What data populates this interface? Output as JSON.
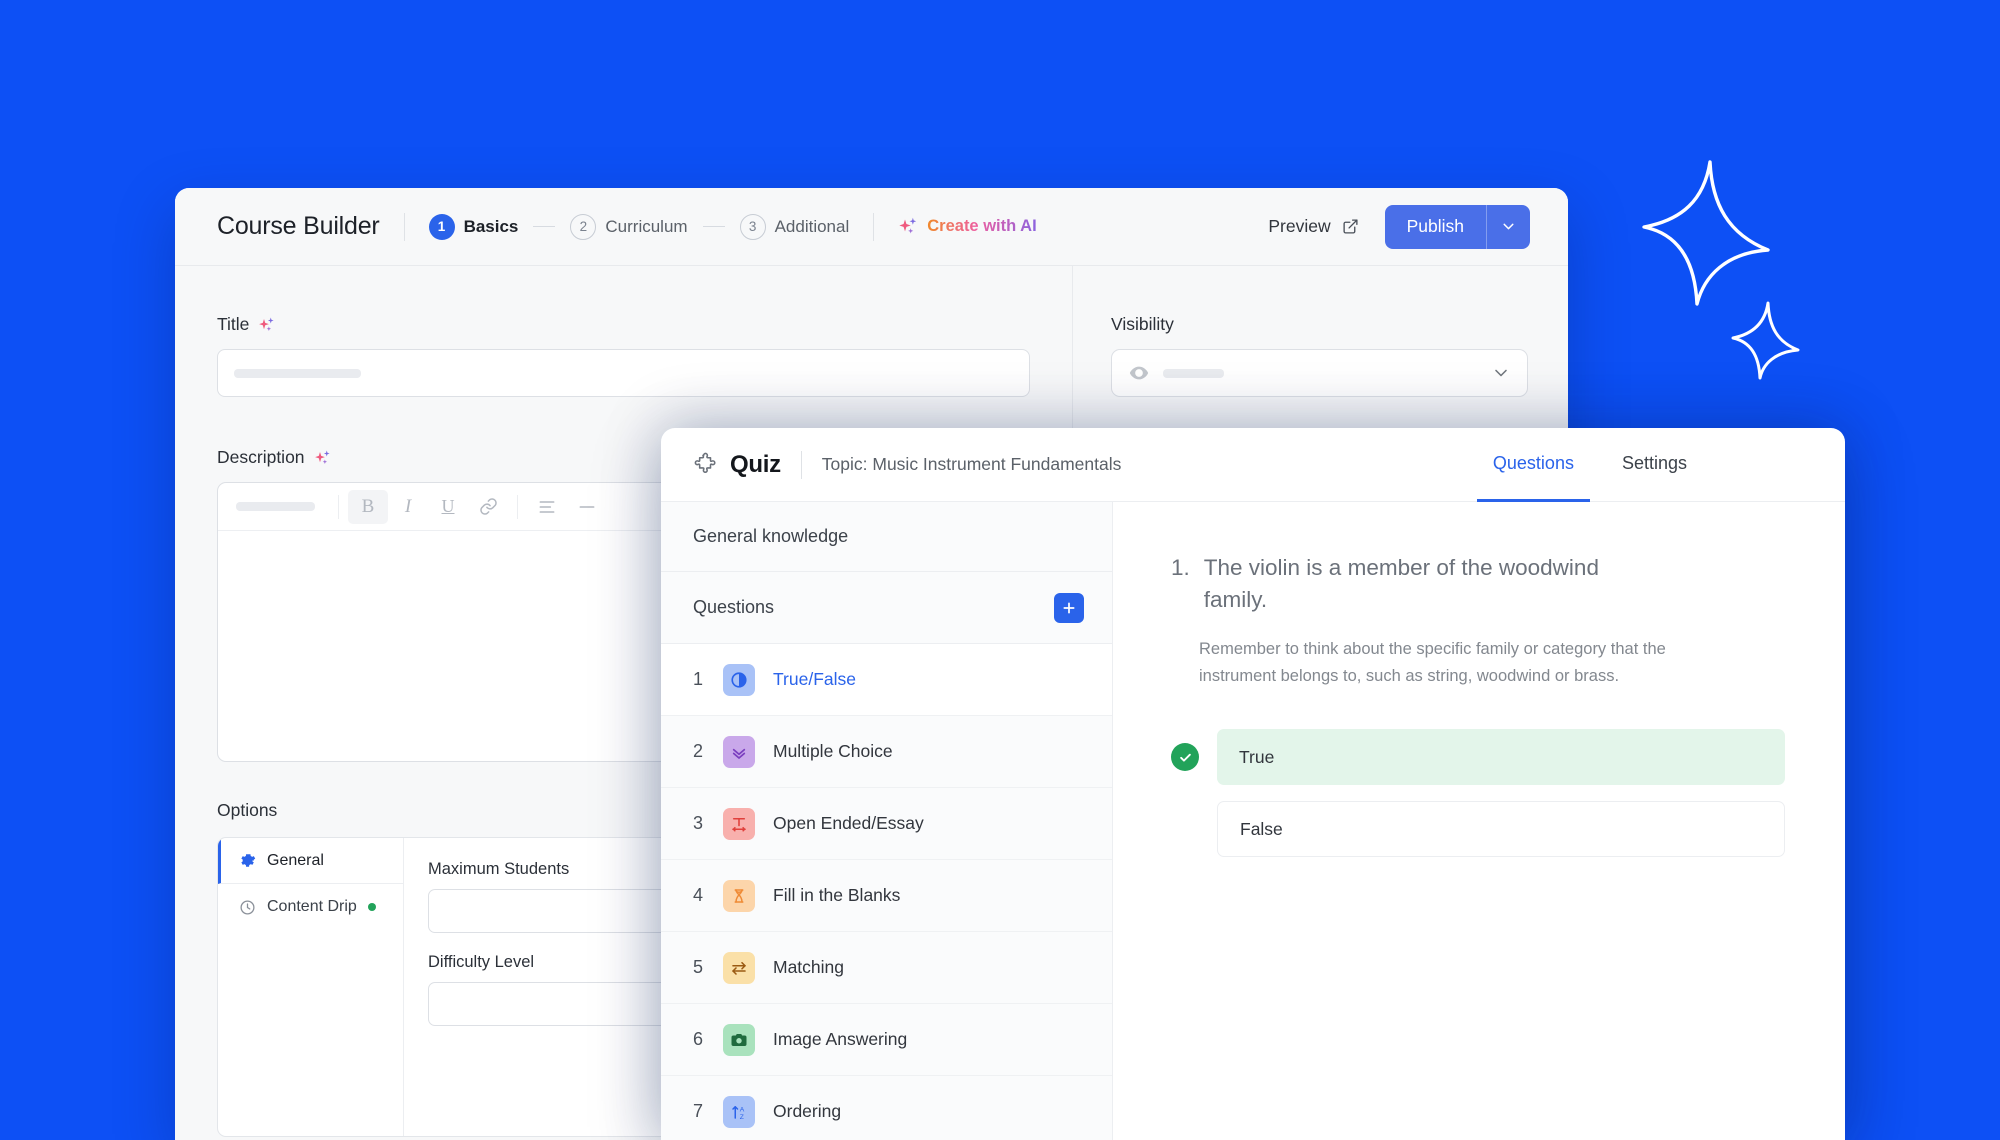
{
  "background": {
    "color": "#0d50f5"
  },
  "sparkles": [
    {
      "name": "sparkle-large"
    },
    {
      "name": "sparkle-small"
    }
  ],
  "course_builder": {
    "title": "Course Builder",
    "steps": [
      {
        "num": "1",
        "label": "Basics",
        "state": "active"
      },
      {
        "num": "2",
        "label": "Curriculum",
        "state": "idle"
      },
      {
        "num": "3",
        "label": "Additional",
        "state": "idle"
      }
    ],
    "create_with_ai": {
      "label": "Create with AI",
      "icon": "sparkles-icon"
    },
    "preview": {
      "label": "Preview",
      "icon": "external-link-icon"
    },
    "publish": {
      "label": "Publish",
      "dropdown_icon": "chevron-down-icon",
      "color": "#4a6fe8"
    },
    "fields": {
      "title": {
        "label": "Title",
        "ai_icon": "sparkles-icon",
        "value": ""
      },
      "visibility": {
        "label": "Visibility",
        "icon": "eye-icon",
        "value": "",
        "chevron": "chevron-down-icon"
      },
      "description": {
        "label": "Description",
        "ai_icon": "sparkles-icon",
        "value": ""
      }
    },
    "editor_toolbar": [
      {
        "name": "format-dropdown",
        "glyph": ""
      },
      {
        "name": "bold-icon",
        "glyph": "B"
      },
      {
        "name": "italic-icon",
        "glyph": "I"
      },
      {
        "name": "underline-icon",
        "glyph": "U"
      },
      {
        "name": "link-icon",
        "glyph": "🔗"
      },
      {
        "name": "align-left-icon",
        "glyph": "☰"
      },
      {
        "name": "horizontal-rule-icon",
        "glyph": "—"
      }
    ],
    "options": {
      "title": "Options",
      "tabs": [
        {
          "label": "General",
          "icon": "gear-icon",
          "active": true,
          "dot": false
        },
        {
          "label": "Content Drip",
          "icon": "clock-icon",
          "active": false,
          "dot": true,
          "dot_color": "#22a35a"
        }
      ],
      "form": [
        {
          "label": "Maximum Students",
          "value": ""
        },
        {
          "label": "Difficulty Level",
          "value": ""
        }
      ]
    }
  },
  "quiz": {
    "brand_icon": "puzzle-piece-icon",
    "brand": "Quiz",
    "topic": "Topic: Music Instrument Fundamentals",
    "tabs": [
      {
        "label": "Questions",
        "active": true
      },
      {
        "label": "Settings",
        "active": false
      }
    ],
    "group_name": "General knowledge",
    "questions_header": "Questions",
    "add_button_icon": "plus-icon",
    "questions": [
      {
        "num": "1",
        "label": "True/False",
        "icon": "contrast-circle-icon",
        "bg": "#a9c2f7",
        "fg": "#2a63ea",
        "active": true
      },
      {
        "num": "2",
        "label": "Multiple Choice",
        "icon": "double-check-icon",
        "bg": "#c9a8ea",
        "fg": "#7b3fbf",
        "active": false
      },
      {
        "num": "3",
        "label": "Open Ended/Essay",
        "icon": "text-expand-icon",
        "bg": "#f8b0ad",
        "fg": "#e0403c",
        "active": false
      },
      {
        "num": "4",
        "label": "Fill in the Blanks",
        "icon": "hourglass-icon",
        "bg": "#fcd5aa",
        "fg": "#ef8b36",
        "active": false
      },
      {
        "num": "5",
        "label": "Matching",
        "icon": "swap-arrows-icon",
        "bg": "#fae0a8",
        "fg": "#9a5a12",
        "active": false
      },
      {
        "num": "6",
        "label": "Image Answering",
        "icon": "camera-icon",
        "bg": "#a9e2bd",
        "fg": "#1f6b3e",
        "active": false
      },
      {
        "num": "7",
        "label": "Ordering",
        "icon": "sort-az-icon",
        "bg": "#a9c2f7",
        "fg": "#2a63ea",
        "active": false
      }
    ],
    "detail": {
      "number": "1.",
      "text": "The violin is a member of the woodwind family.",
      "hint": "Remember to think about the specific family or category that the instrument belongs to, such as string, woodwind or brass.",
      "answers": [
        {
          "label": "True",
          "correct": true,
          "check_icon": "check-circle-icon",
          "color": "#e3f5ea"
        },
        {
          "label": "False",
          "correct": false,
          "check_icon": "",
          "color": "#ffffff"
        }
      ]
    }
  }
}
